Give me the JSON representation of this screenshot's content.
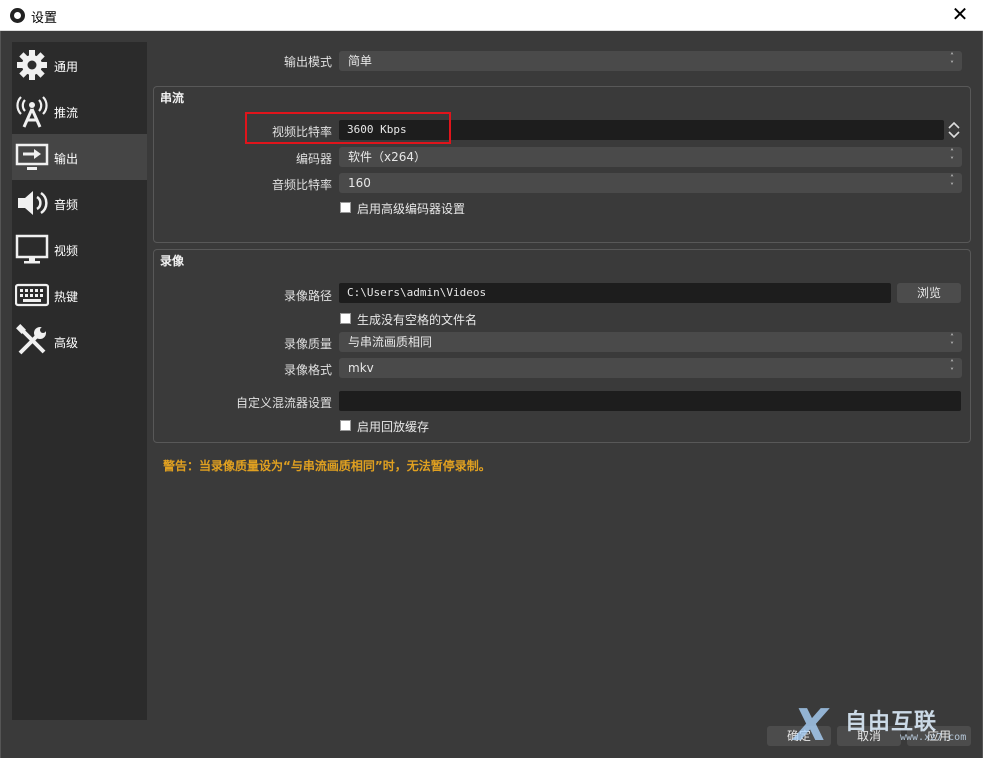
{
  "window": {
    "title": "设置",
    "close_glyph": "✕"
  },
  "sidebar": {
    "items": [
      {
        "label": "通用",
        "icon": "gear-icon"
      },
      {
        "label": "推流",
        "icon": "broadcast-tower-icon"
      },
      {
        "label": "输出",
        "icon": "output-monitor-icon",
        "active": true
      },
      {
        "label": "音频",
        "icon": "speaker-icon"
      },
      {
        "label": "视频",
        "icon": "monitor-icon"
      },
      {
        "label": "热键",
        "icon": "keyboard-icon"
      },
      {
        "label": "高级",
        "icon": "tools-icon"
      }
    ]
  },
  "output_mode": {
    "label": "输出模式",
    "value": "简单"
  },
  "streaming": {
    "title": "串流",
    "video_bitrate": {
      "label": "视频比特率",
      "value": "3600 Kbps"
    },
    "encoder": {
      "label": "编码器",
      "value": "软件（x264）"
    },
    "audio_bitrate": {
      "label": "音频比特率",
      "value": "160"
    },
    "advanced_encoder": {
      "label": "启用高级编码器设置",
      "checked": false
    }
  },
  "recording": {
    "title": "录像",
    "path": {
      "label": "录像路径",
      "value": "C:\\Users\\admin\\Videos",
      "browse": "浏览"
    },
    "no_space": {
      "label": "生成没有空格的文件名",
      "checked": false
    },
    "quality": {
      "label": "录像质量",
      "value": "与串流画质相同"
    },
    "format": {
      "label": "录像格式",
      "value": "mkv"
    },
    "muxer": {
      "label": "自定义混流器设置",
      "value": ""
    },
    "replay_buffer": {
      "label": "启用回放缓存",
      "checked": false
    }
  },
  "warning": "警告：当录像质量设为“与串流画质相同”时，无法暂停录制。",
  "buttons": {
    "ok": "确定",
    "cancel": "取消",
    "apply": "应用"
  },
  "watermark": {
    "mark": "X",
    "text": "自由互联",
    "domain": "www.xz7.com"
  },
  "colors": {
    "background": "#3a3a3a",
    "sidebar": "#2b2b2b",
    "active": "#454545",
    "highlight": "#e0141b",
    "warning": "#e0a020"
  }
}
